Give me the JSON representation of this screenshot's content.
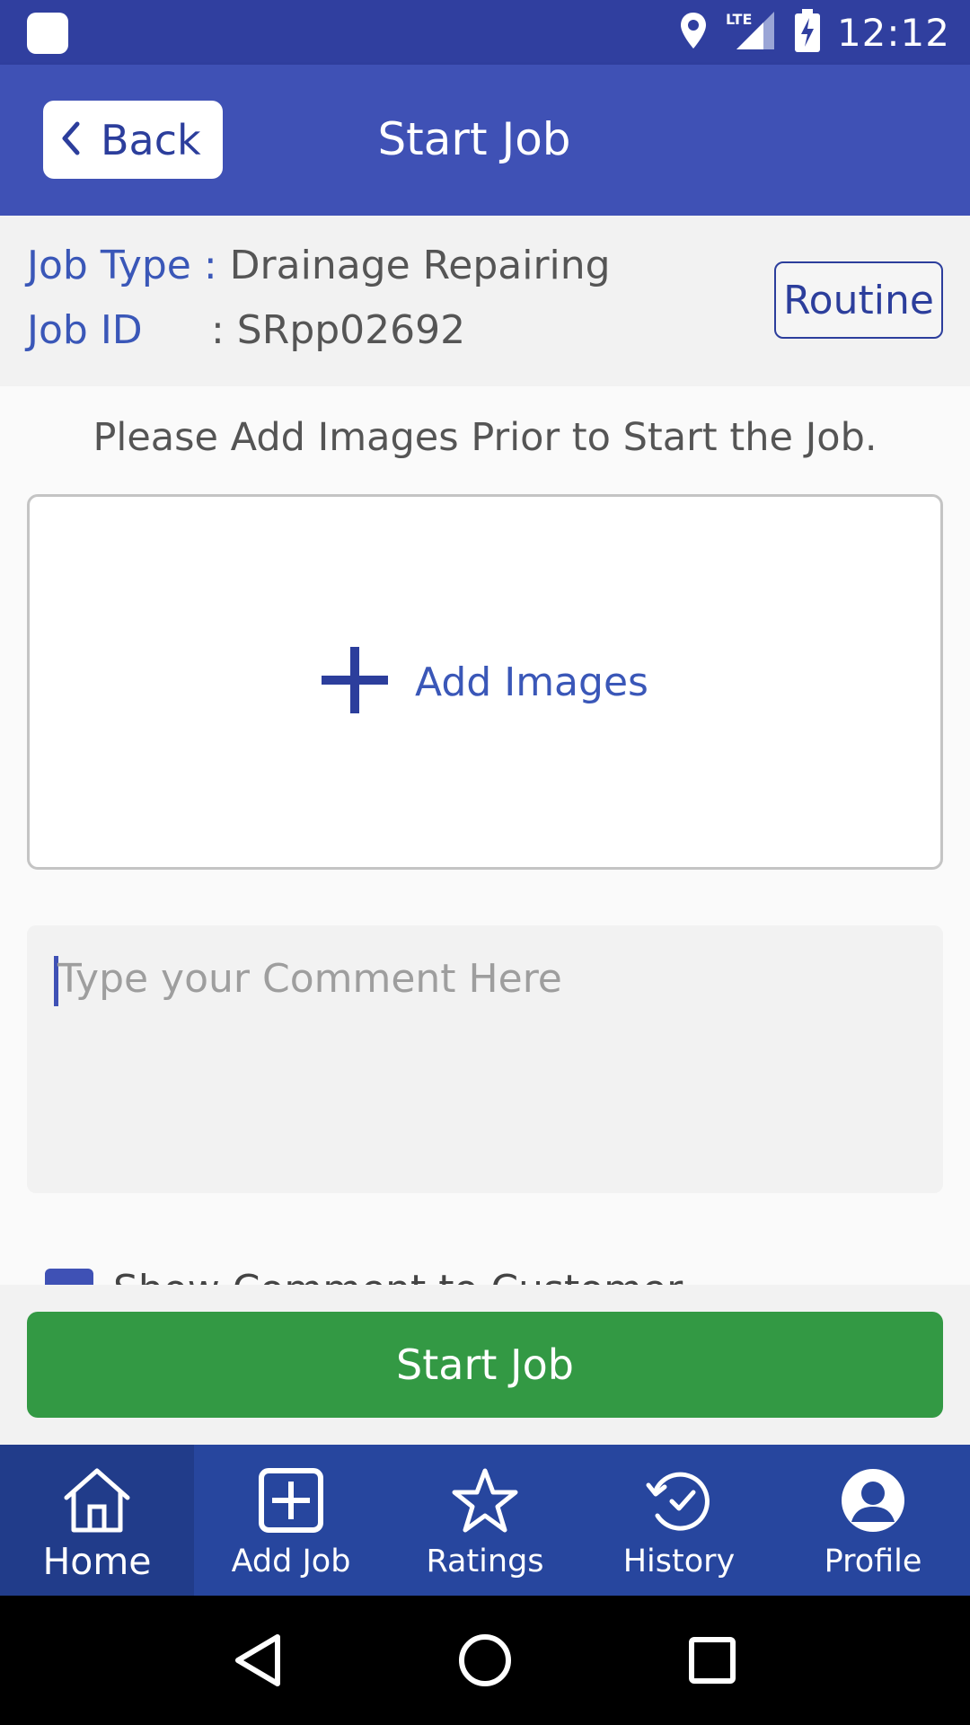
{
  "status_bar": {
    "time": "12:12",
    "network": "LTE"
  },
  "app_bar": {
    "back_label": "Back",
    "title": "Start Job"
  },
  "job": {
    "type_label": "Job Type :",
    "type_value": " Drainage Repairing",
    "id_label": "Job ID",
    "id_value": ": SRpp02692",
    "priority_badge": "Routine"
  },
  "instruction": "Please Add Images Prior to Start the Job.",
  "add_images_label": "Add Images",
  "comment": {
    "placeholder": "Type your Comment Here",
    "value": ""
  },
  "show_comment_checkbox": {
    "label": "Show Comment to Customer",
    "checked": true
  },
  "start_button_label": "Start Job",
  "bottom_nav": [
    {
      "label": "Home",
      "icon": "home-icon",
      "active": true
    },
    {
      "label": "Add Job",
      "icon": "add-box-icon",
      "active": false
    },
    {
      "label": "Ratings",
      "icon": "star-icon",
      "active": false
    },
    {
      "label": "History",
      "icon": "history-icon",
      "active": false
    },
    {
      "label": "Profile",
      "icon": "profile-icon",
      "active": false
    }
  ],
  "colors": {
    "primary": "#3f51b5",
    "primary_dark": "#303f9f",
    "accent_text": "#3a57b8",
    "start_button": "#339944",
    "bottom_nav": "#27469e"
  }
}
